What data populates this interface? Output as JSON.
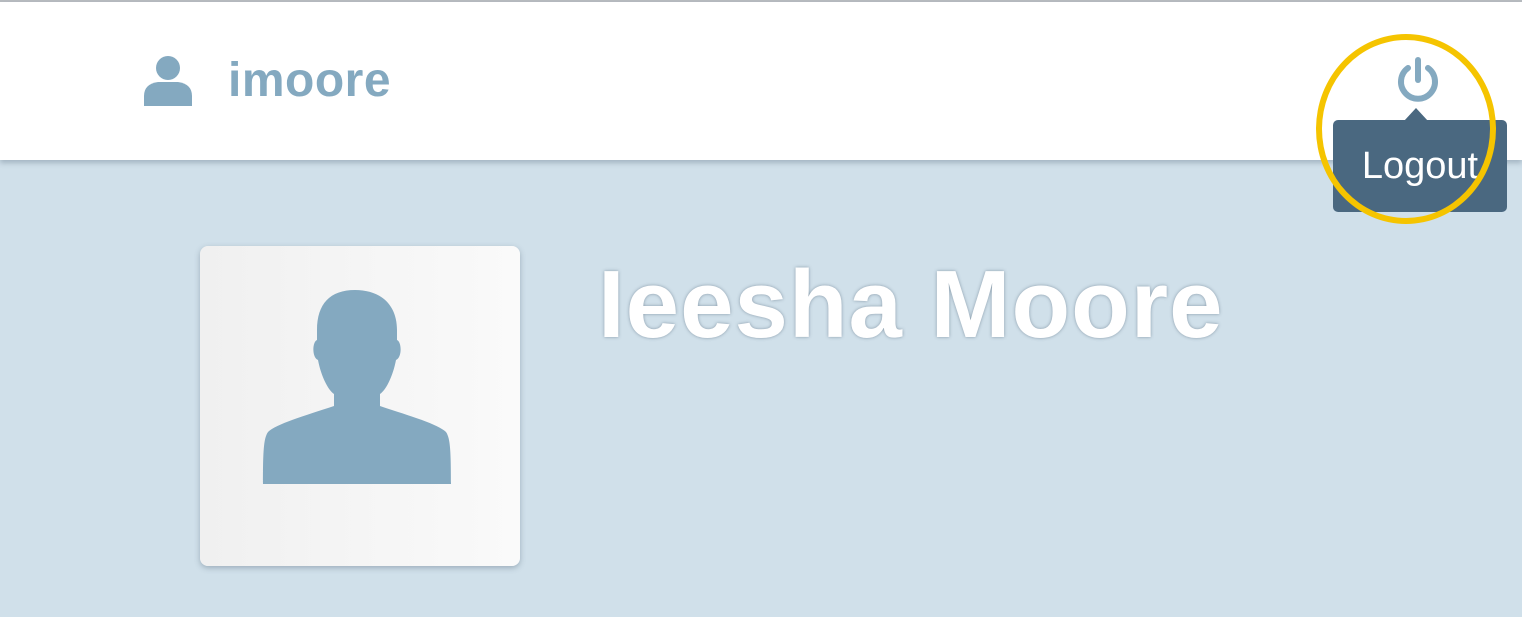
{
  "header": {
    "username": "imoore",
    "user_icon": "person-icon",
    "logout_icon": "power-icon",
    "logout_tooltip": "Logout"
  },
  "profile": {
    "full_name": "Ieesha Moore",
    "avatar_icon": "avatar-placeholder-icon"
  },
  "annotation": {
    "highlight_color": "#f5c400"
  },
  "colors": {
    "accent": "#84a9c0",
    "tooltip_bg": "#4a6880",
    "content_bg": "#d0e0ea",
    "header_bg": "#ffffff"
  }
}
